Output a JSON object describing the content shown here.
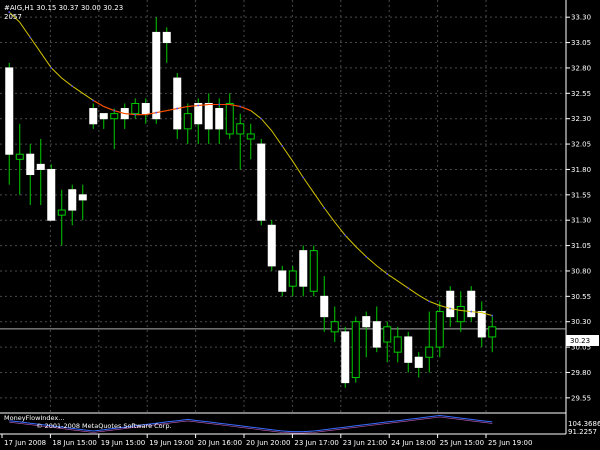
{
  "header": {
    "symbol_line": "#AIG,H1  30.15 30.37 30.00 30.23",
    "sub_line": "2057"
  },
  "price_axis": {
    "ticks": [
      "33.30",
      "33.05",
      "32.80",
      "32.55",
      "32.30",
      "32.05",
      "31.80",
      "31.55",
      "31.30",
      "31.05",
      "30.80",
      "30.55",
      "30.30",
      "30.05",
      "29.80",
      "29.55"
    ],
    "current_price_label": "30.23"
  },
  "indicator": {
    "label": "MoneyFlowIndex...",
    "copyright": "© 2001-2008 MetaQuotes Software Corp.",
    "axis_top": "104.3686",
    "axis_bottom": "91.2257"
  },
  "time_axis": {
    "labels": [
      "17 Jun 2008",
      "18 Jun 15:00",
      "19 Jun 15:00",
      "19 Jun 19:00",
      "20 Jun 16:00",
      "20 Jun 20:00",
      "23 Jun 17:00",
      "23 Jun 21:00",
      "24 Jun 18:00",
      "25 Jun 15:00",
      "25 Jun 19:00"
    ]
  },
  "colors": {
    "background": "#000000",
    "bull_body": "#ffffff",
    "bear_body": "#000000",
    "wick": "#00cc00",
    "grid": "#4a4a4a",
    "ma_line": "#d4c400",
    "ma_dots": "#5050ff",
    "ma_segment": "#ff4000",
    "price_line": "#b0b0b0"
  },
  "chart_data": {
    "type": "candlestick",
    "ylim": [
      29.45,
      33.42
    ],
    "candles": [
      {
        "o": 31.95,
        "h": 32.85,
        "l": 31.65,
        "c": 32.8,
        "dir": "up"
      },
      {
        "o": 31.9,
        "h": 32.25,
        "l": 31.55,
        "c": 31.95,
        "dir": "down"
      },
      {
        "o": 31.75,
        "h": 32.05,
        "l": 31.45,
        "c": 31.95,
        "dir": "up"
      },
      {
        "o": 31.8,
        "h": 32.1,
        "l": 31.45,
        "c": 31.85,
        "dir": "up"
      },
      {
        "o": 31.3,
        "h": 31.85,
        "l": 31.3,
        "c": 31.8,
        "dir": "up"
      },
      {
        "o": 31.35,
        "h": 31.6,
        "l": 31.05,
        "c": 31.4,
        "dir": "down"
      },
      {
        "o": 31.4,
        "h": 31.65,
        "l": 31.25,
        "c": 31.6,
        "dir": "up"
      },
      {
        "o": 31.5,
        "h": 31.65,
        "l": 31.3,
        "c": 31.55,
        "dir": "up"
      },
      {
        "o": 32.25,
        "h": 32.45,
        "l": 32.2,
        "c": 32.4,
        "dir": "up"
      },
      {
        "o": 32.3,
        "h": 32.35,
        "l": 32.2,
        "c": 32.35,
        "dir": "up"
      },
      {
        "o": 32.3,
        "h": 32.4,
        "l": 32.0,
        "c": 32.35,
        "dir": "down"
      },
      {
        "o": 32.3,
        "h": 32.45,
        "l": 32.2,
        "c": 32.4,
        "dir": "up"
      },
      {
        "o": 32.35,
        "h": 32.5,
        "l": 32.3,
        "c": 32.45,
        "dir": "down"
      },
      {
        "o": 32.35,
        "h": 32.5,
        "l": 32.25,
        "c": 32.45,
        "dir": "up"
      },
      {
        "o": 32.3,
        "h": 33.3,
        "l": 32.25,
        "c": 33.15,
        "dir": "up"
      },
      {
        "o": 33.15,
        "h": 33.2,
        "l": 32.85,
        "c": 33.05,
        "dir": "up"
      },
      {
        "o": 32.2,
        "h": 32.75,
        "l": 32.1,
        "c": 32.7,
        "dir": "up"
      },
      {
        "o": 32.2,
        "h": 32.45,
        "l": 32.05,
        "c": 32.35,
        "dir": "down"
      },
      {
        "o": 32.25,
        "h": 32.5,
        "l": 32.05,
        "c": 32.45,
        "dir": "up"
      },
      {
        "o": 32.2,
        "h": 32.55,
        "l": 32.05,
        "c": 32.45,
        "dir": "up"
      },
      {
        "o": 32.2,
        "h": 32.5,
        "l": 32.05,
        "c": 32.4,
        "dir": "up"
      },
      {
        "o": 32.15,
        "h": 32.55,
        "l": 32.1,
        "c": 32.45,
        "dir": "down"
      },
      {
        "o": 32.15,
        "h": 32.35,
        "l": 31.8,
        "c": 32.25,
        "dir": "down"
      },
      {
        "o": 32.15,
        "h": 32.25,
        "l": 31.9,
        "c": 32.1,
        "dir": "down"
      },
      {
        "o": 31.3,
        "h": 32.1,
        "l": 31.25,
        "c": 32.05,
        "dir": "up"
      },
      {
        "o": 30.85,
        "h": 31.3,
        "l": 30.8,
        "c": 31.25,
        "dir": "up"
      },
      {
        "o": 30.6,
        "h": 30.85,
        "l": 30.55,
        "c": 30.8,
        "dir": "up"
      },
      {
        "o": 30.65,
        "h": 30.85,
        "l": 30.55,
        "c": 30.8,
        "dir": "down"
      },
      {
        "o": 30.65,
        "h": 31.05,
        "l": 30.55,
        "c": 31.0,
        "dir": "up"
      },
      {
        "o": 30.6,
        "h": 31.05,
        "l": 30.55,
        "c": 31.0,
        "dir": "down"
      },
      {
        "o": 30.35,
        "h": 30.75,
        "l": 30.2,
        "c": 30.55,
        "dir": "up"
      },
      {
        "o": 30.2,
        "h": 30.45,
        "l": 30.1,
        "c": 30.3,
        "dir": "down"
      },
      {
        "o": 29.7,
        "h": 30.25,
        "l": 29.65,
        "c": 30.2,
        "dir": "up"
      },
      {
        "o": 29.75,
        "h": 30.35,
        "l": 29.7,
        "c": 30.3,
        "dir": "down"
      },
      {
        "o": 30.25,
        "h": 30.4,
        "l": 29.95,
        "c": 30.35,
        "dir": "up"
      },
      {
        "o": 30.05,
        "h": 30.45,
        "l": 30.0,
        "c": 30.3,
        "dir": "up"
      },
      {
        "o": 30.1,
        "h": 30.3,
        "l": 29.9,
        "c": 30.25,
        "dir": "down"
      },
      {
        "o": 30.0,
        "h": 30.25,
        "l": 29.9,
        "c": 30.15,
        "dir": "down"
      },
      {
        "o": 29.9,
        "h": 30.2,
        "l": 29.8,
        "c": 30.15,
        "dir": "up"
      },
      {
        "o": 29.85,
        "h": 30.0,
        "l": 29.75,
        "c": 29.95,
        "dir": "up"
      },
      {
        "o": 29.95,
        "h": 30.4,
        "l": 29.8,
        "c": 30.05,
        "dir": "down"
      },
      {
        "o": 30.05,
        "h": 30.5,
        "l": 29.95,
        "c": 30.4,
        "dir": "down"
      },
      {
        "o": 30.35,
        "h": 30.65,
        "l": 30.25,
        "c": 30.6,
        "dir": "up"
      },
      {
        "o": 30.3,
        "h": 30.6,
        "l": 30.2,
        "c": 30.45,
        "dir": "down"
      },
      {
        "o": 30.35,
        "h": 30.65,
        "l": 30.3,
        "c": 30.6,
        "dir": "up"
      },
      {
        "o": 30.15,
        "h": 30.5,
        "l": 30.05,
        "c": 30.4,
        "dir": "up"
      },
      {
        "o": 30.15,
        "h": 30.35,
        "l": 30.0,
        "c": 30.25,
        "dir": "down"
      }
    ],
    "ma": [
      33.35,
      33.25,
      33.1,
      32.95,
      32.8,
      32.7,
      32.62,
      32.55,
      32.48,
      32.42,
      32.38,
      32.35,
      32.34,
      32.34,
      32.36,
      32.38,
      32.4,
      32.42,
      32.43,
      32.44,
      32.44,
      32.44,
      32.42,
      32.38,
      32.3,
      32.18,
      32.03,
      31.88,
      31.72,
      31.57,
      31.42,
      31.28,
      31.15,
      31.04,
      30.94,
      30.85,
      30.77,
      30.7,
      30.63,
      30.56,
      30.5,
      30.46,
      30.43,
      30.41,
      30.4,
      30.39,
      30.36
    ],
    "current_price": 30.23,
    "mfi": [
      100,
      99,
      98,
      97,
      96,
      95,
      94,
      93,
      92,
      93,
      94,
      95,
      96,
      97,
      98,
      99,
      100,
      101,
      100,
      99,
      98,
      97,
      96,
      95,
      94,
      93,
      92,
      91.5,
      91.5,
      92,
      93,
      94,
      95,
      96,
      97,
      98,
      99,
      100,
      101,
      102,
      103,
      104,
      103,
      102,
      101,
      100,
      99
    ]
  }
}
